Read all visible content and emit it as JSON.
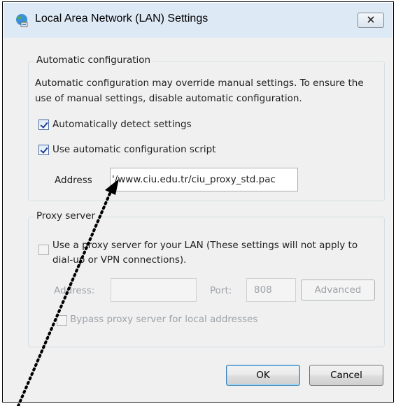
{
  "window": {
    "title": "Local Area Network (LAN) Settings",
    "icon": "network-globe-icon",
    "close_icon": "close-icon"
  },
  "auto_config": {
    "legend": "Automatic configuration",
    "description_line1": "Automatic configuration may override manual settings.  To ensure the",
    "description_line2": "use of manual settings, disable automatic configuration.",
    "detect_label": "Automatically detect settings",
    "detect_checked": true,
    "script_label": "Use automatic configuration script",
    "script_checked": true,
    "address_label": "Address",
    "address_value": "'/www.ciu.edu.tr/ciu_proxy_std.pac"
  },
  "proxy": {
    "legend": "Proxy server",
    "use_proxy_line1": "Use a proxy server for your LAN (These settings will not apply to",
    "use_proxy_line2": "dial-up or VPN connections).",
    "use_proxy_checked": false,
    "address_label": "Address:",
    "address_value": "",
    "port_label": "Port:",
    "port_value": "808",
    "advanced_label": "Advanced",
    "bypass_label": "Bypass proxy server for local addresses",
    "bypass_checked": false
  },
  "buttons": {
    "ok": "OK",
    "cancel": "Cancel"
  },
  "colors": {
    "titlebar": "#dee9f6",
    "dialog_bg": "#f0f0f0",
    "disabled_text": "#9ea3a8",
    "arrow": "#000000"
  }
}
